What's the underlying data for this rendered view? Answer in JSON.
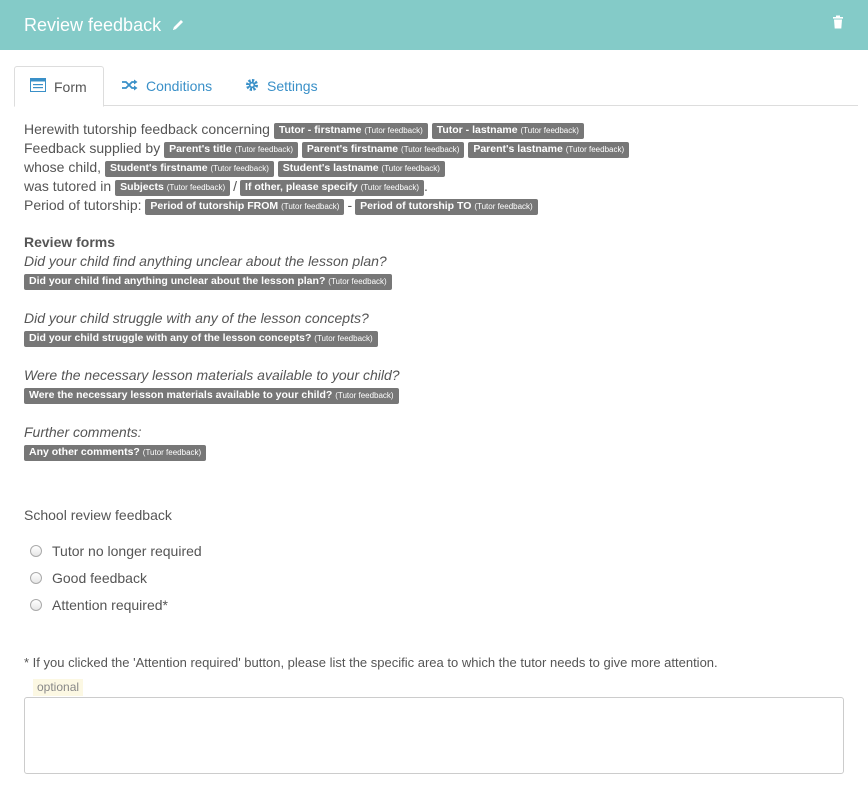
{
  "header": {
    "title": "Review feedback"
  },
  "tabs": [
    {
      "label": "Form"
    },
    {
      "label": "Conditions"
    },
    {
      "label": "Settings"
    }
  ],
  "intro": {
    "line1_text": "Herewith tutorship feedback concerning",
    "line2_text": "Feedback supplied by",
    "line3_text": "whose child,",
    "line4_text": "was tutored in",
    "line4_sep": "/",
    "line4_end": ".",
    "line5_text": "Period of tutorship:",
    "line5_sep": "-",
    "tag_suffix": "(Tutor feedback)",
    "tags": {
      "tutor_firstname": "Tutor - firstname",
      "tutor_lastname": "Tutor - lastname",
      "parent_title": "Parent's title",
      "parent_firstname": "Parent's firstname",
      "parent_lastname": "Parent's lastname",
      "student_firstname": "Student's firstname",
      "student_lastname": "Student's lastname",
      "subjects": "Subjects",
      "if_other": "If other, please specify",
      "period_from": "Period of tutorship FROM",
      "period_to": "Period of tutorship TO"
    }
  },
  "review": {
    "title": "Review forms",
    "questions": [
      {
        "text": "Did your child find anything unclear about the lesson plan?",
        "tag": "Did your child find anything unclear about the lesson plan?"
      },
      {
        "text": "Did your child struggle with any of the lesson concepts?",
        "tag": "Did your child struggle with any of the lesson concepts?"
      },
      {
        "text": "Were the necessary lesson materials available to your child?",
        "tag": "Were the necessary lesson materials available to your child?"
      },
      {
        "text": "Further comments:",
        "tag": "Any other comments?"
      }
    ]
  },
  "school": {
    "label": "School review feedback",
    "options": [
      {
        "label": "Tutor no longer required"
      },
      {
        "label": "Good feedback"
      },
      {
        "label": "Attention required*"
      }
    ],
    "note": "* If you clicked the 'Attention required' button, please list the specific area to which the tutor needs to give more attention.",
    "optional_badge": "optional",
    "textarea_value": ""
  }
}
